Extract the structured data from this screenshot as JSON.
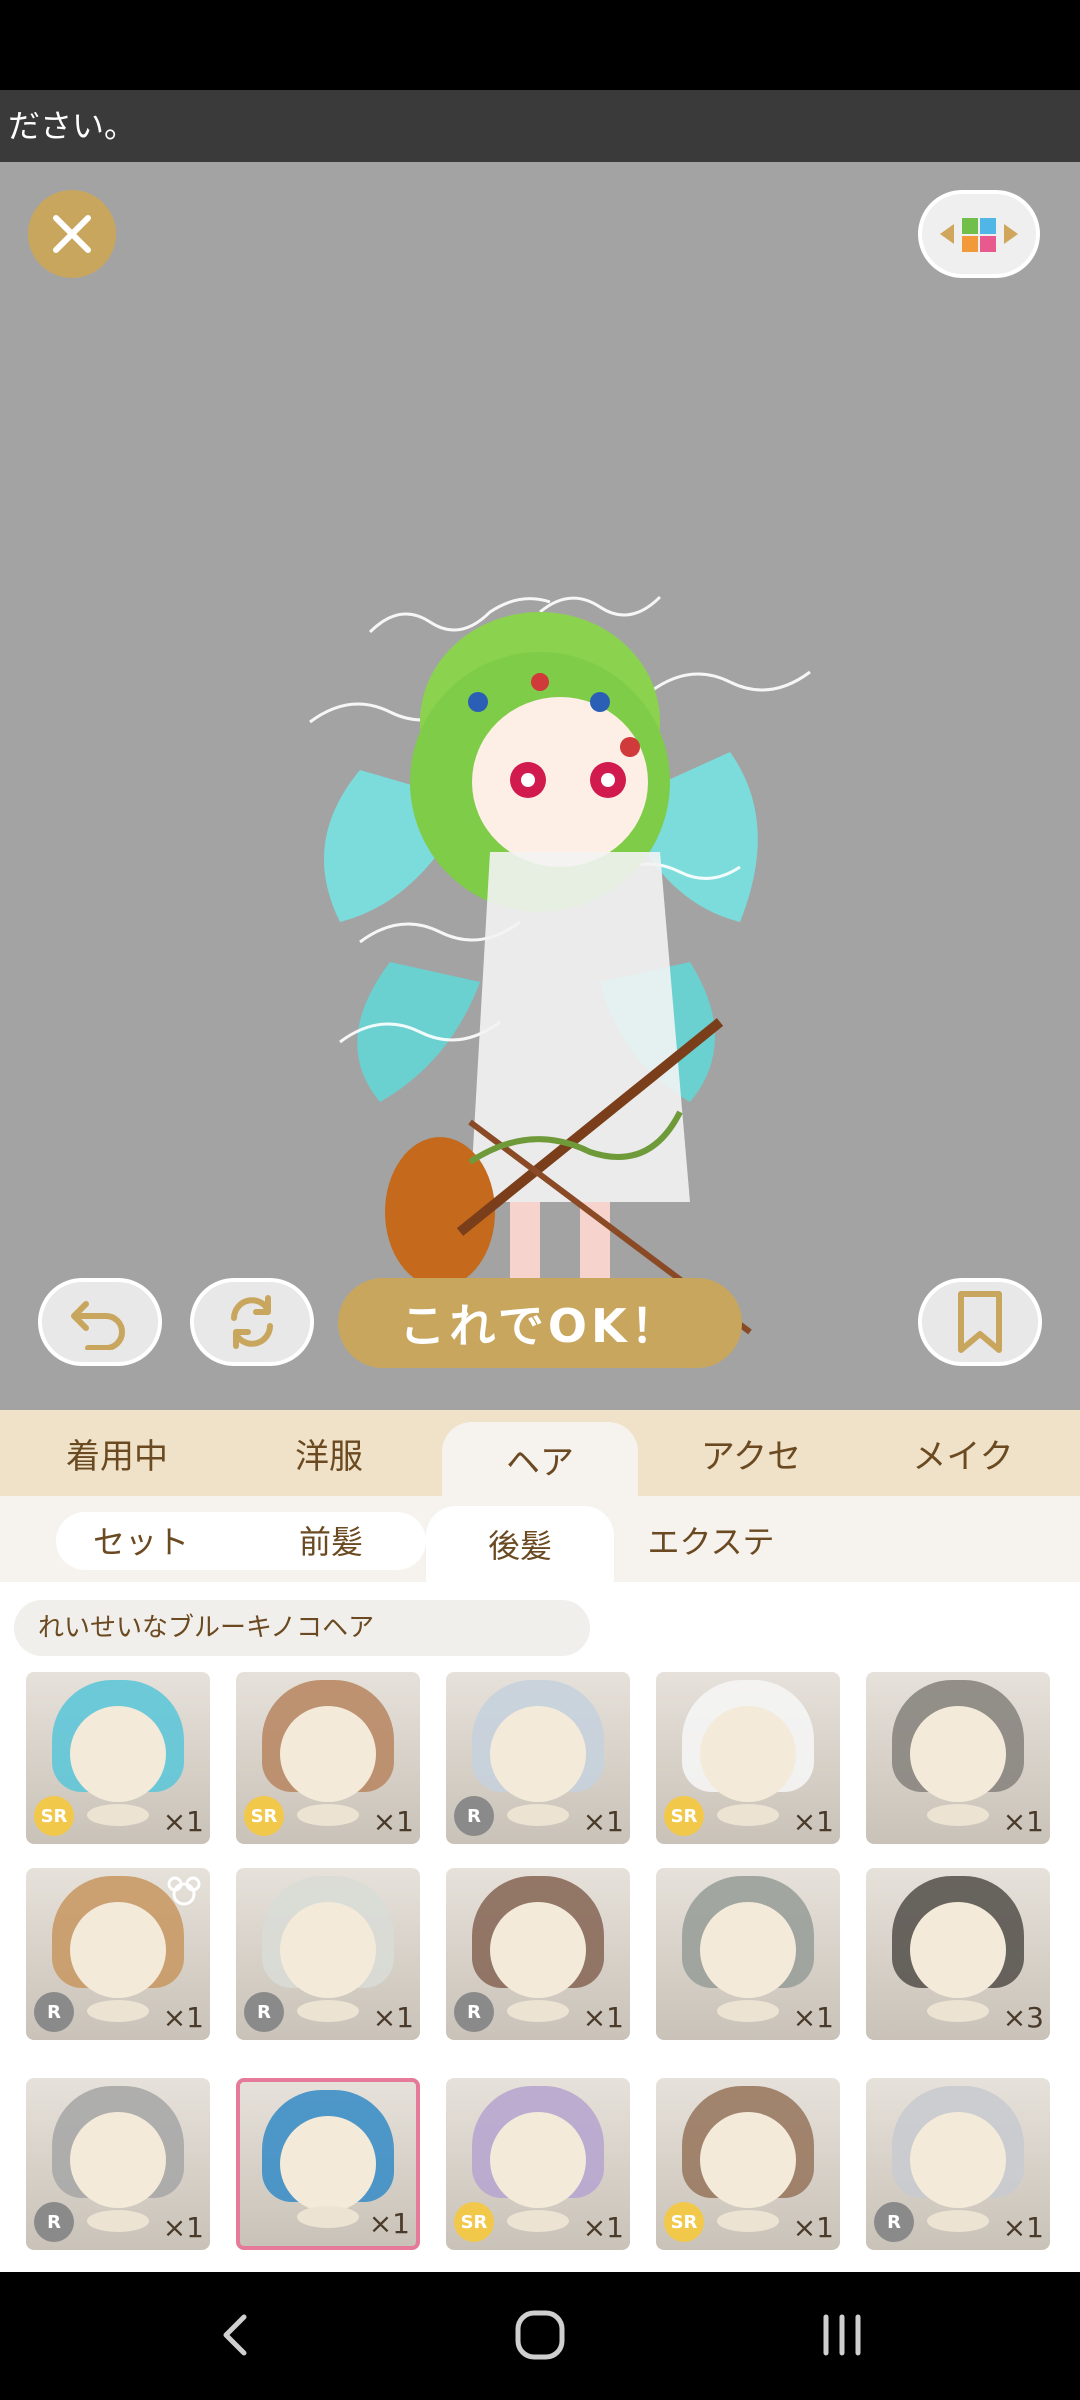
{
  "notice": {
    "text": "ださい。"
  },
  "actions": {
    "ok_label": "これでOK！"
  },
  "tabs": [
    {
      "label": "着用中"
    },
    {
      "label": "洋服"
    },
    {
      "label": "ヘア"
    },
    {
      "label": "アクセ"
    },
    {
      "label": "メイク"
    }
  ],
  "subtabs": [
    {
      "label": "セット"
    },
    {
      "label": "前髪"
    },
    {
      "label": "後髪"
    },
    {
      "label": "エクステ"
    }
  ],
  "selected_item_name": "れいせいなブルーキノコヘア",
  "items": [
    {
      "rarity": "SR",
      "count": "×1",
      "hair": "#5fc7d8"
    },
    {
      "rarity": "SR",
      "count": "×1",
      "hair": "#b98a66"
    },
    {
      "rarity": "R",
      "count": "×1",
      "hair": "#c7d2dd"
    },
    {
      "rarity": "SR",
      "count": "×1",
      "hair": "#f5f5f5"
    },
    {
      "rarity": "",
      "count": "×1",
      "hair": "#8a8580"
    },
    {
      "rarity": "R",
      "count": "×1",
      "hair": "#c99a66"
    },
    {
      "rarity": "R",
      "count": "×1",
      "hair": "#d9dcd6"
    },
    {
      "rarity": "R",
      "count": "×1",
      "hair": "#8a6a5a"
    },
    {
      "rarity": "",
      "count": "×1",
      "hair": "#9aa09a"
    },
    {
      "rarity": "",
      "count": "×3",
      "hair": "#5a5550"
    },
    {
      "rarity": "R",
      "count": "×1",
      "hair": "#a8a8a8"
    },
    {
      "rarity": "",
      "count": "×1",
      "hair": "#3d8fc6"
    },
    {
      "rarity": "SR",
      "count": "×1",
      "hair": "#b7a6cf"
    },
    {
      "rarity": "SR",
      "count": "×1",
      "hair": "#9a7a62"
    },
    {
      "rarity": "R",
      "count": "×1",
      "hair": "#c9cbcf"
    }
  ],
  "colors": {
    "accent": "#c8a65e",
    "tab_bg": "#efe2c8",
    "tab_text": "#6b4a22",
    "stage_bg": "#a3a3a3"
  }
}
